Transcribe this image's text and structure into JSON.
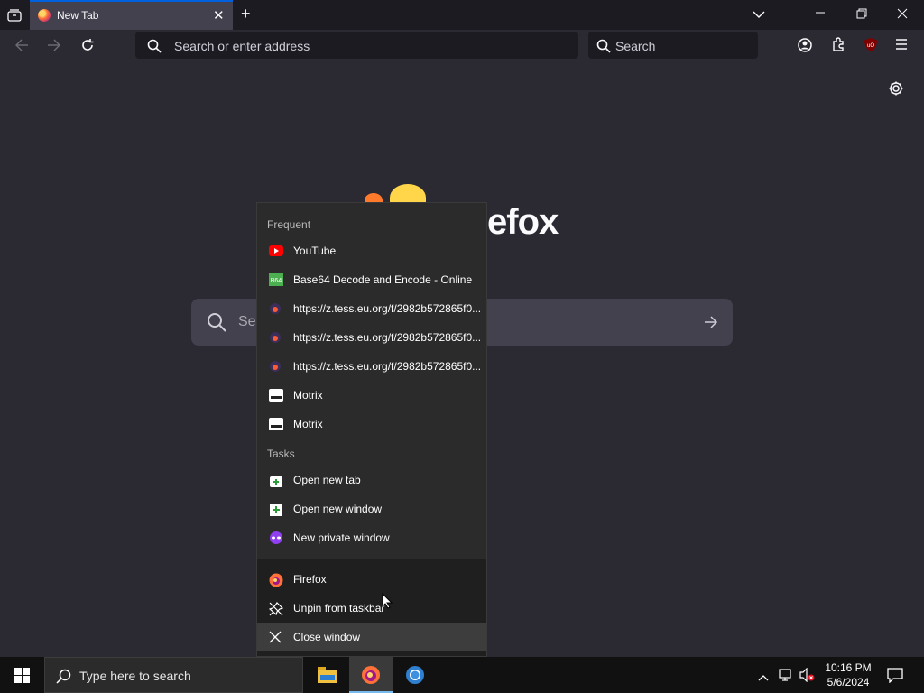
{
  "window": {
    "tab_title": "New Tab",
    "url_placeholder": "Search or enter address",
    "search_placeholder": "Search"
  },
  "newtab": {
    "logo_text": "efox",
    "search_partial": "Se"
  },
  "jumplist": {
    "frequent_header": "Frequent",
    "frequent": [
      {
        "label": "YouTube",
        "icon": "youtube-icon"
      },
      {
        "label": "Base64 Decode and Encode - Online",
        "icon": "base64-icon"
      },
      {
        "label": "https://z.tess.eu.org/f/2982b572865f0...",
        "icon": "firefox-page-icon"
      },
      {
        "label": "https://z.tess.eu.org/f/2982b572865f0...",
        "icon": "firefox-page-icon"
      },
      {
        "label": "https://z.tess.eu.org/f/2982b572865f0...",
        "icon": "firefox-page-icon"
      },
      {
        "label": "Motrix",
        "icon": "motrix-icon"
      },
      {
        "label": "Motrix",
        "icon": "motrix-icon"
      }
    ],
    "tasks_header": "Tasks",
    "tasks": [
      {
        "label": "Open new tab",
        "icon": "new-tab-icon"
      },
      {
        "label": "Open new window",
        "icon": "new-window-icon"
      },
      {
        "label": "New private window",
        "icon": "private-window-icon"
      }
    ],
    "app_items": [
      {
        "label": "Firefox",
        "icon": "firefox-icon"
      },
      {
        "label": "Unpin from taskbar",
        "icon": "unpin-icon"
      },
      {
        "label": "Close window",
        "icon": "close-icon"
      }
    ]
  },
  "taskbar": {
    "search_placeholder": "Type here to search",
    "time": "10:16 PM",
    "date": "5/6/2024"
  },
  "colors": {
    "accent": "#0060df",
    "youtube": "#ff0000",
    "base64": "#4caf50",
    "private": "#8f3ef0"
  }
}
